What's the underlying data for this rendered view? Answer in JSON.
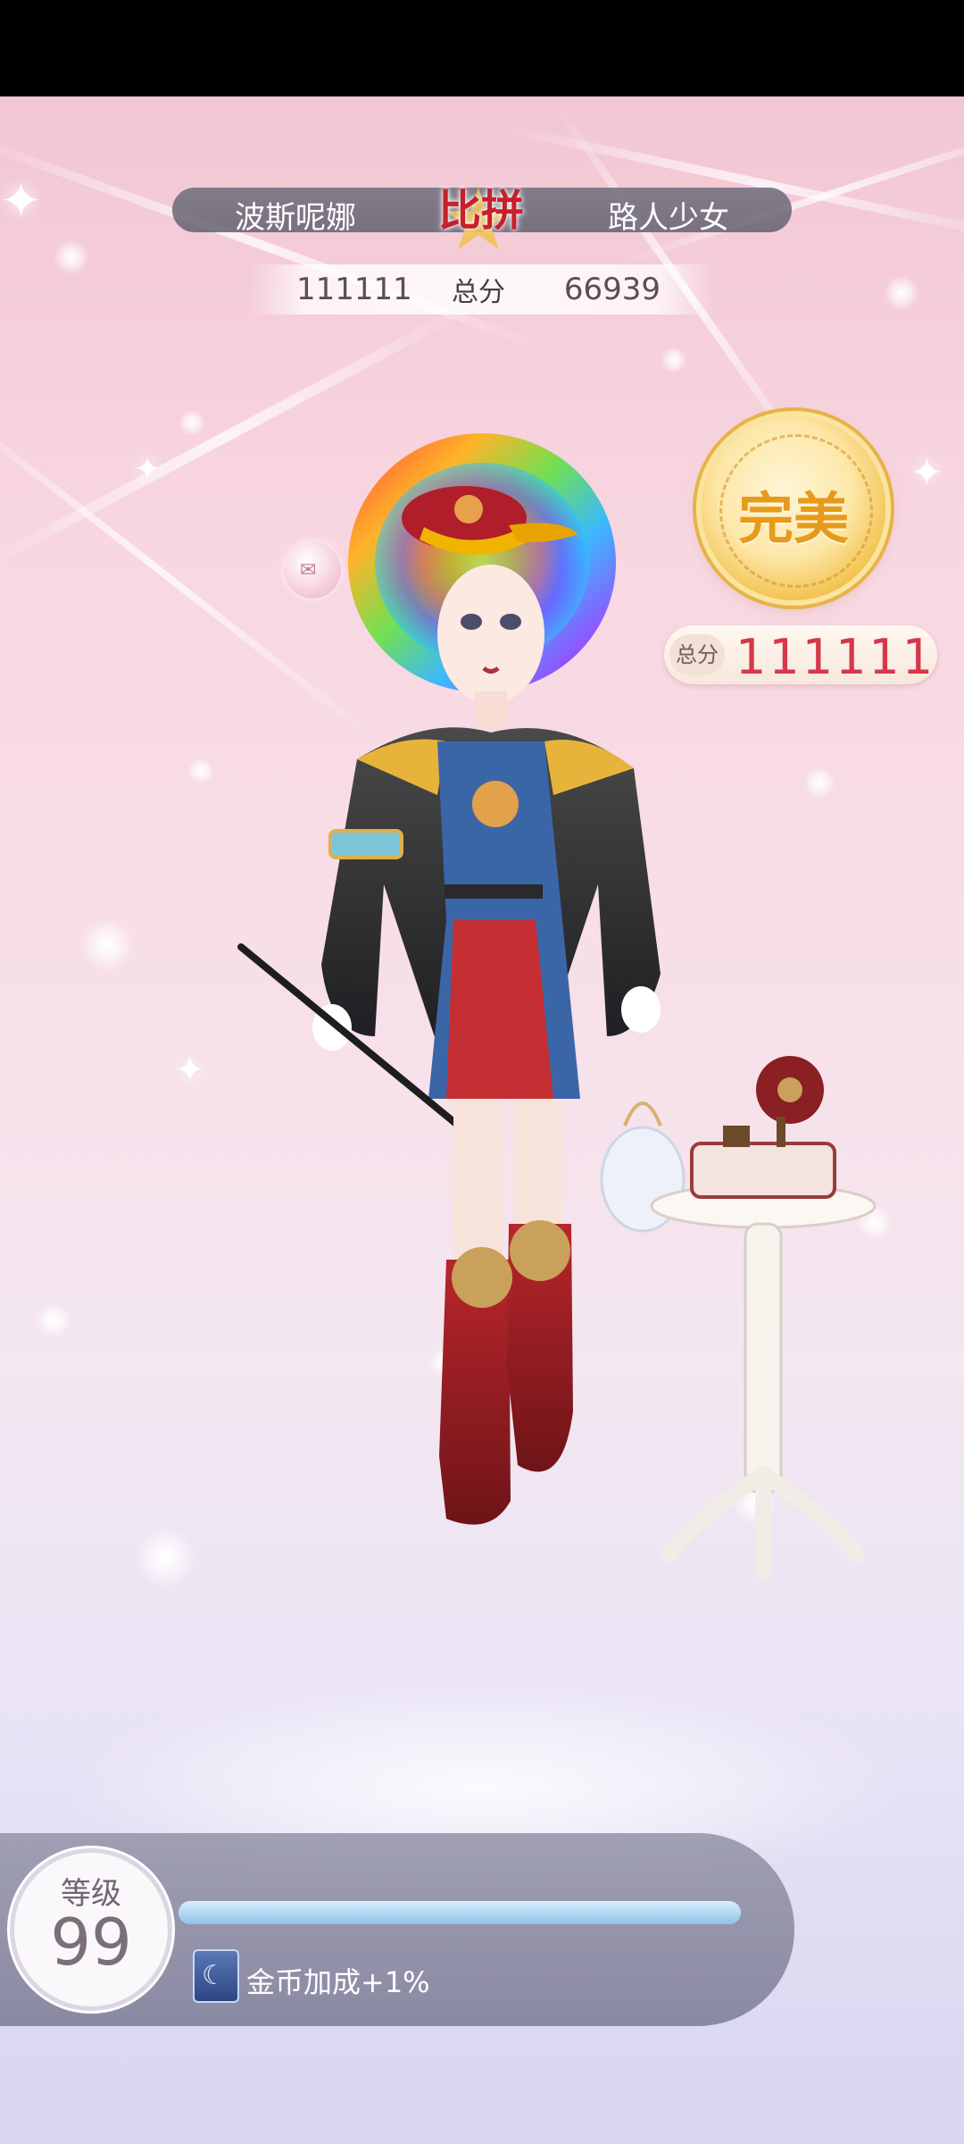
{
  "battle": {
    "title": "比拼",
    "left_player": "波斯呢娜",
    "right_player": "路人少女",
    "left_score": "111111",
    "right_score": "66939",
    "score_label": "总分"
  },
  "result": {
    "medal_text": "完美",
    "total_label": "总分",
    "total_value": "111111"
  },
  "level": {
    "label": "等级",
    "value": "99",
    "progress": 1.0,
    "bonus_text": "金币加成+1%",
    "bonus_icon": "moon-card-icon"
  },
  "colors": {
    "vs_red": "#c81f2b",
    "score_red": "#d6374a",
    "medal_gold": "#e79a1c",
    "xp_blue": "#8fc2ea"
  }
}
